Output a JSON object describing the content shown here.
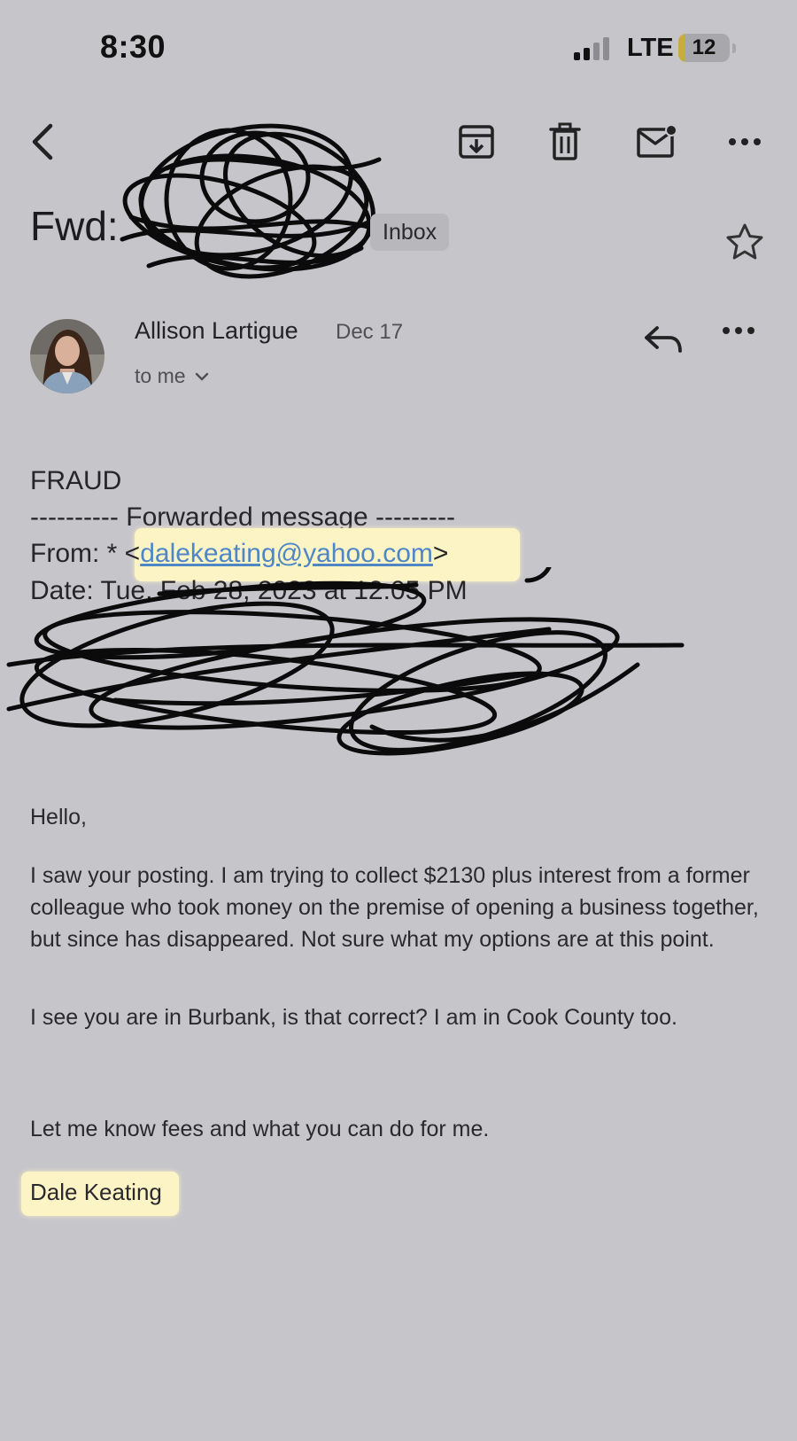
{
  "status_bar": {
    "time": "8:30",
    "network": "LTE",
    "battery": "12",
    "battery_level": 0.12
  },
  "toolbar": {
    "icons": [
      "back-icon",
      "archive-icon",
      "trash-icon",
      "mark-unread-icon",
      "more-horizontal-icon"
    ]
  },
  "email": {
    "subject_prefix": "Fwd:",
    "label": "Inbox",
    "sender_name": "Allison Lartigue",
    "date": "Dec 17",
    "recipient": "to me",
    "body": {
      "opening": "FRAUD",
      "forward_header": "---------- Forwarded message ---------",
      "from_prefix": "From: * <",
      "from_email": "dalekeating@yahoo.com",
      "from_suffix": ">",
      "date_line": "Date: Tue, Feb 28, 2023 at 12:05 PM",
      "greeting": "Hello,",
      "paragraph1": "I saw your posting. I am trying to collect $2130 plus interest from a former colleague who took money on the premise of opening a business together, but since has disappeared. Not sure what my options are at this point.",
      "paragraph2": "I see you are in Burbank, is that correct? I am in Cook County too.",
      "paragraph3": "Let me know fees and what you can do for me.",
      "signature": "Dale Keating"
    }
  }
}
